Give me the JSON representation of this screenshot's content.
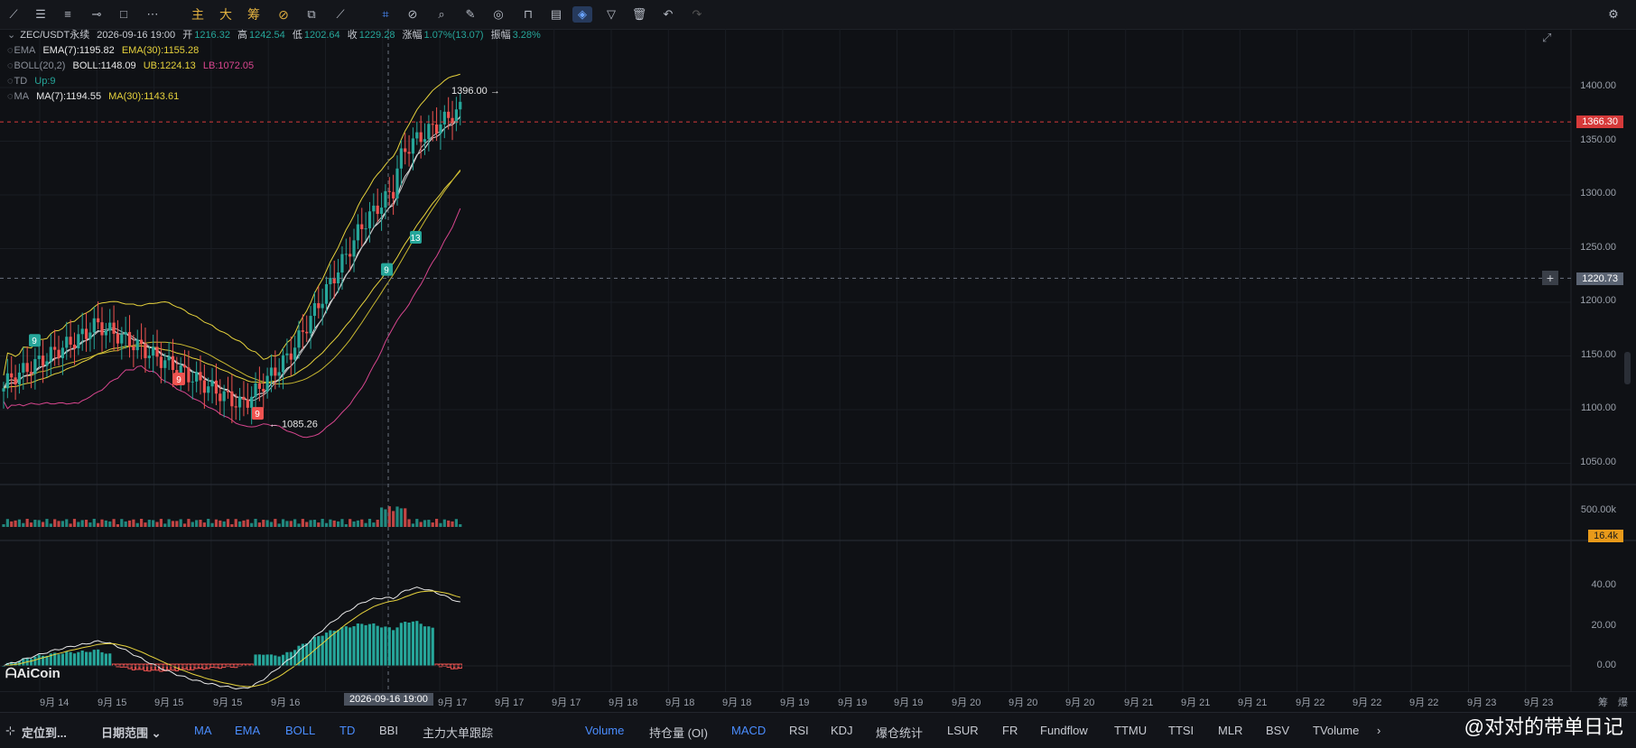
{
  "toolbar": {
    "icons": [
      "pen-tool-icon",
      "menu-lines-icon",
      "list-icon",
      "horizontal-line-icon",
      "rectangle-icon",
      "dots-icon",
      "main-text",
      "large-text",
      "chips-text",
      "fib-icon",
      "measure-icon",
      "ruler-icon",
      "magnet-icon",
      "zoom-icon",
      "brush-icon",
      "eye-icon",
      "lock-icon",
      "layers-icon",
      "magnet-active-icon",
      "filter-icon",
      "trash-icon",
      "undo-icon",
      "redo-icon"
    ],
    "main_label": "主",
    "big_label": "大",
    "chip_label": "筹"
  },
  "header": {
    "symbol": "ZEC/USDT永续",
    "datetime": "2026-09-16 19:00",
    "open_label": "开",
    "open": "1216.32",
    "high_label": "高",
    "high": "1242.54",
    "low_label": "低",
    "low": "1202.64",
    "close_label": "收",
    "close": "1229.28",
    "change_label": "涨幅",
    "change": "1.07%(13.07)",
    "amp_label": "振幅",
    "amp": "3.28%"
  },
  "indicators": {
    "ema": {
      "name": "EMA",
      "v1": "EMA(7):1195.82",
      "v2": "EMA(30):1155.28"
    },
    "boll": {
      "name": "BOLL(20,2)",
      "v1": "BOLL:1148.09",
      "v2": "UB:1224.13",
      "v3": "LB:1072.05"
    },
    "td": {
      "name": "TD",
      "v1": "Up:9"
    },
    "ma": {
      "name": "MA",
      "v1": "MA(7):1194.55",
      "v2": "MA(30):1143.61"
    }
  },
  "annotations": {
    "high_mark": "1396.00",
    "low_mark": "1085.26",
    "td_labels": [
      "9",
      "13",
      "9",
      "9",
      "9"
    ]
  },
  "price_axis": [
    "1400.00",
    "1350.00",
    "1300.00",
    "1250.00",
    "1200.00",
    "1150.00",
    "1100.00",
    "1050.00"
  ],
  "volume_axis": "500.00k",
  "volume_badge": "16.4k",
  "macd_axis": [
    "40.00",
    "20.00",
    "0.00"
  ],
  "current_price": "1366.30",
  "crosshair_price": "1220.73",
  "crosshair_time": "2026-09-16 19:00",
  "time_axis": [
    "9月 14",
    "9月 15",
    "9月 15",
    "9月 15",
    "9月 16",
    "9月",
    "9月 17",
    "9月 17",
    "9月 17",
    "9月 18",
    "9月 18",
    "9月 18",
    "9月 19",
    "9月 19",
    "9月 19",
    "9月 20",
    "9月 20",
    "9月 20",
    "9月 21",
    "9月 21",
    "9月 21",
    "9月 22",
    "9月 22",
    "9月 22",
    "9月 23",
    "9月 23"
  ],
  "axis_right_labels": [
    "筹",
    "爆"
  ],
  "logo": "AiCoin",
  "bottom": {
    "locate": "定位到...",
    "range": "日期范围",
    "main_tabs": [
      "MA",
      "EMA",
      "BOLL",
      "TD",
      "BBI",
      "主力大单跟踪"
    ],
    "sub_tabs": [
      "Volume",
      "持仓量 (OI)",
      "MACD",
      "RSI",
      "KDJ",
      "爆仓统计",
      "LSUR",
      "FR",
      "Fundflow",
      "TTMU",
      "TTSI",
      "MLR",
      "BSV",
      "TVolume"
    ]
  },
  "watermark": "@对对的带单日记",
  "colors": {
    "up": "#26a69a",
    "down": "#ef5350",
    "ema7": "#e8e8e8",
    "ema30": "#e6d23c",
    "lb": "#d9468f",
    "accent": "#4a8dff"
  }
}
